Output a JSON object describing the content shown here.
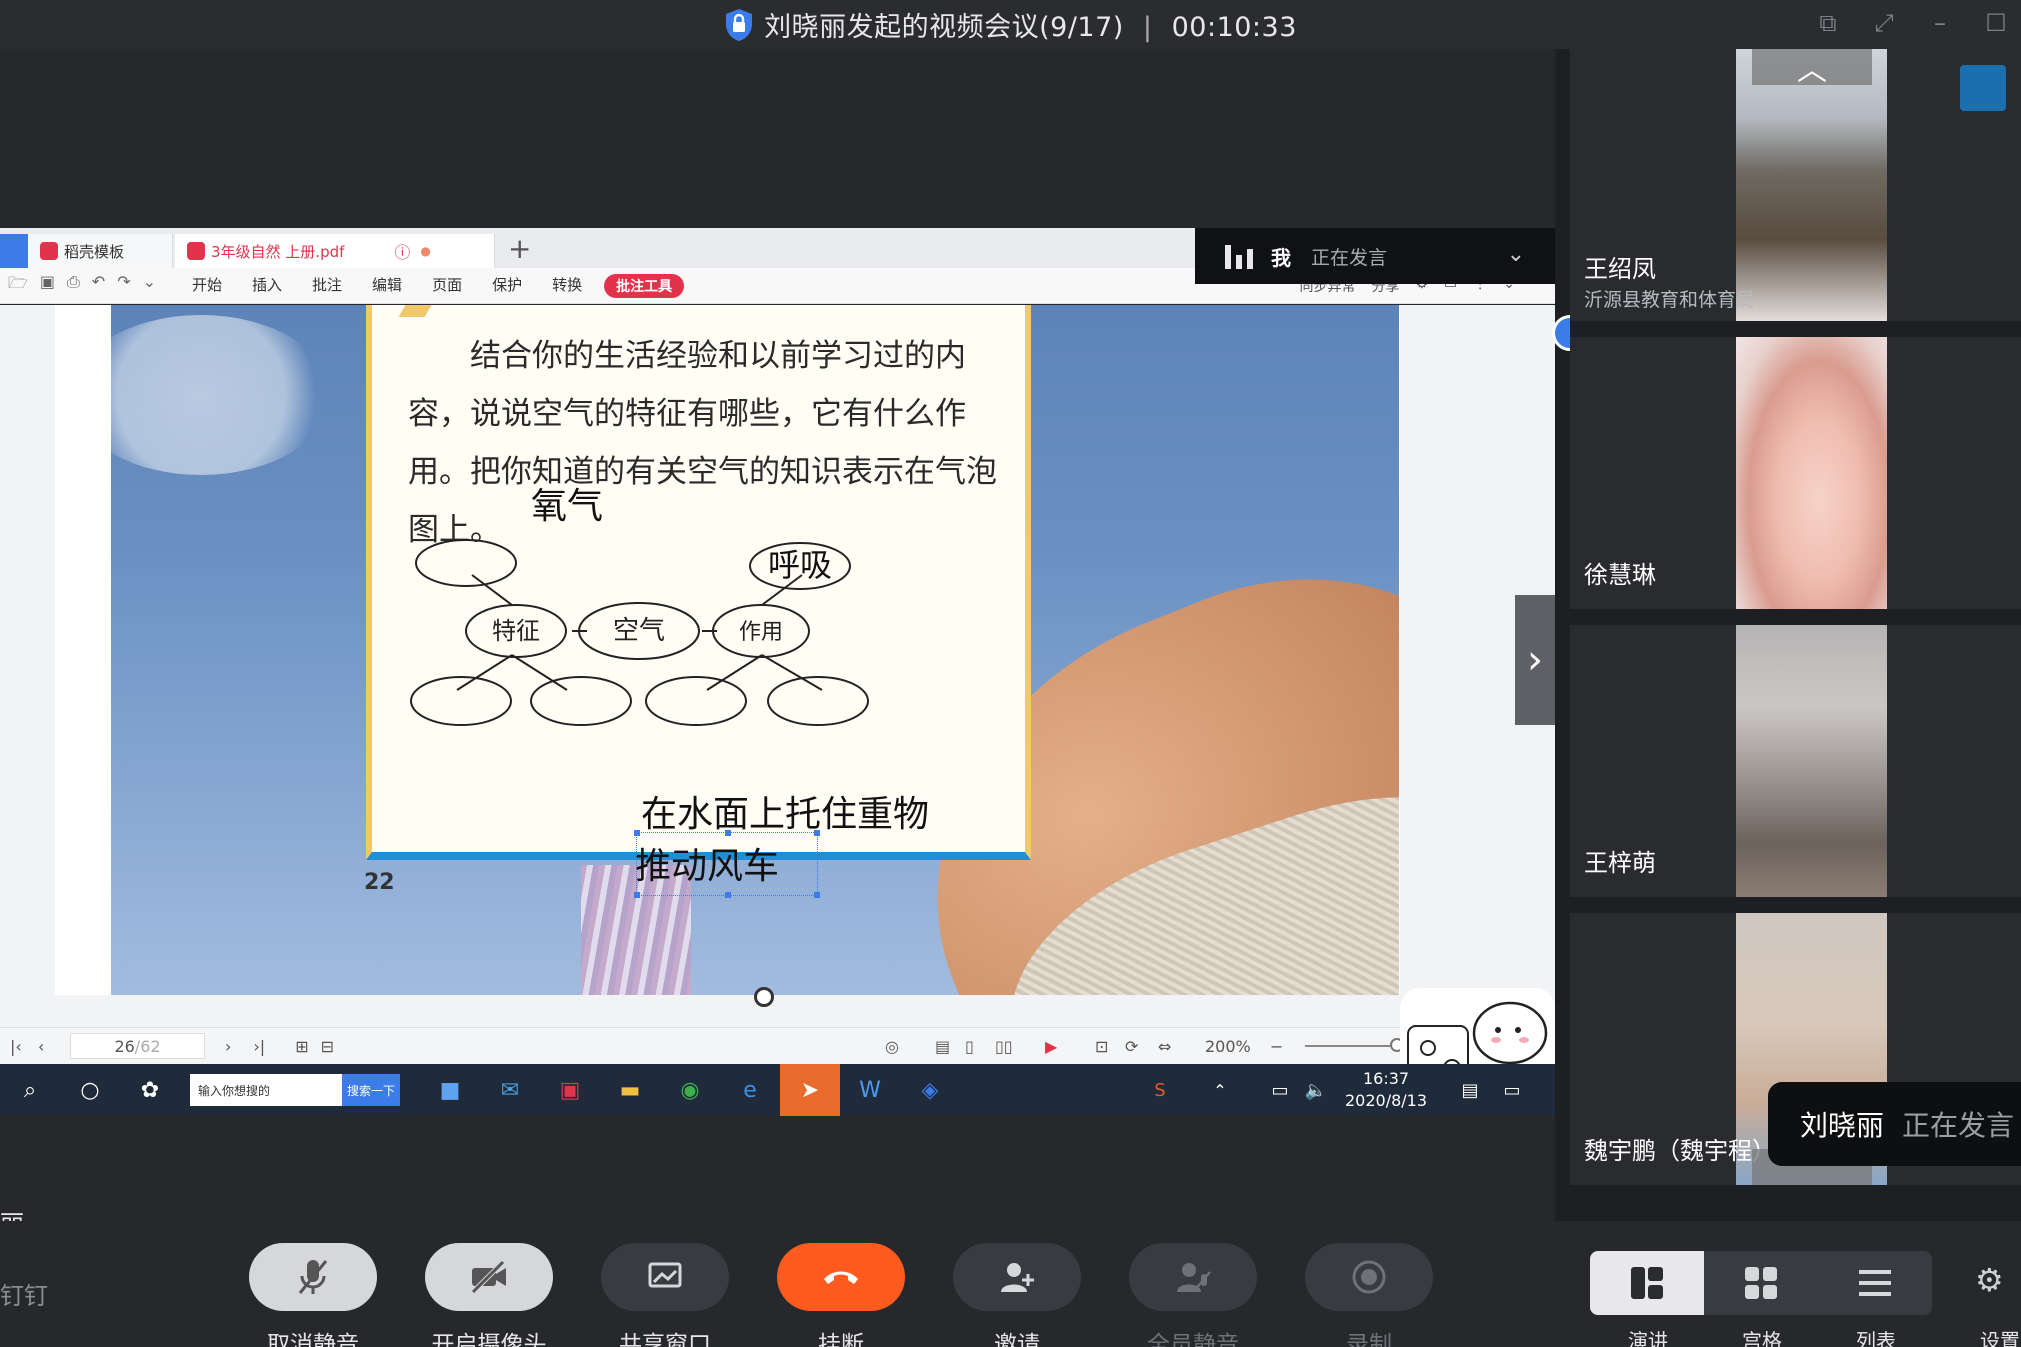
{
  "window": {
    "title": "刘晓丽发起的视频会议(9/17)",
    "separator": "|",
    "timer": "00:10:33"
  },
  "share": {
    "tabs": [
      {
        "label": "稻壳模板",
        "color": "#e2334d"
      },
      {
        "label": "3年级自然 上册.pdf",
        "color": "#e2334d"
      }
    ],
    "tab_add": "+",
    "menu": [
      "开始",
      "插入",
      "批注",
      "编辑",
      "页面",
      "保护",
      "转换"
    ],
    "menu_highlight": "批注工具",
    "right_tools": [
      "同步异常",
      "分享"
    ],
    "speaking_bar": {
      "me": "我",
      "status": "正在发言"
    },
    "page_text": "结合你的生活经验和以前学习过的内容，说说空气的特征有哪些，它有什么作用。把你知道的有关空气的知识表示在气泡图上。",
    "page_number": "22",
    "bubbles": {
      "center": "空气",
      "left": "特征",
      "right": "作用",
      "top_right": "呼吸"
    },
    "annotations": {
      "oxygen": "氧气",
      "line1": "在水面上托住重物",
      "line2": "推动风车"
    },
    "status": {
      "page_current": "26",
      "page_total": "/62",
      "zoom": "200%"
    },
    "taskbar": {
      "search_placeholder": "输入你想搜的",
      "search_button": "搜索一下",
      "time": "16:37",
      "date": "2020/8/13"
    }
  },
  "stage": {
    "presenter_name": "丽"
  },
  "participants": [
    {
      "name": "王绍凤",
      "org": "沂源县教育和体育局"
    },
    {
      "name": "徐慧琳",
      "org": ""
    },
    {
      "name": "王梓萌",
      "org": ""
    },
    {
      "name": "魏宇鹏（魏宇程）",
      "org": ""
    }
  ],
  "toast": {
    "name": "刘晓丽",
    "status": "正在发言"
  },
  "controls": [
    {
      "label": "取消静音",
      "icon": "mic-muted-icon",
      "enabled": true
    },
    {
      "label": "开启摄像头",
      "icon": "camera-off-icon",
      "enabled": true
    },
    {
      "label": "共享窗口",
      "icon": "share-window-icon",
      "enabled": true
    },
    {
      "label": "挂断",
      "icon": "hangup-icon",
      "enabled": true
    },
    {
      "label": "邀请",
      "icon": "invite-icon",
      "enabled": true
    },
    {
      "label": "全员静音",
      "icon": "mute-all-icon",
      "enabled": false
    },
    {
      "label": "录制",
      "icon": "record-icon",
      "enabled": false
    }
  ],
  "brand": "钉钉",
  "views": [
    {
      "label": "演讲",
      "selected": true
    },
    {
      "label": "宫格",
      "selected": false
    },
    {
      "label": "列表",
      "selected": false
    }
  ],
  "settings_label": "设置",
  "colors": {
    "accent": "#3b7ce8",
    "hangup": "#ff5a1f",
    "annot": "#e2334d"
  }
}
